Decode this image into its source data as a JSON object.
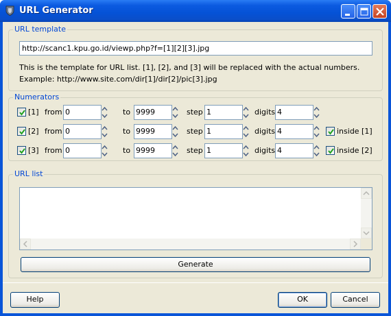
{
  "window": {
    "title": "URL Generator"
  },
  "url_template": {
    "legend": "URL template",
    "value": "http://scanc1.kpu.go.id/viewp.php?f=[1][2][3].jpg",
    "help_line1": "This is the template for URL list. [1], [2], and [3] will be replaced with the actual numbers.",
    "help_line2": "Example: http://www.site.com/dir[1]/dir[2]/pic[3].jpg"
  },
  "numerators": {
    "legend": "Numerators",
    "from_label": "from",
    "to_label": "to",
    "step_label": "step",
    "digits_label": "digits",
    "rows": [
      {
        "label": "[1]",
        "checked": true,
        "from": "0",
        "to": "9999",
        "step": "1",
        "digits": "4",
        "inside_label": ""
      },
      {
        "label": "[2]",
        "checked": true,
        "from": "0",
        "to": "9999",
        "step": "1",
        "digits": "4",
        "inside_label": "inside [1]"
      },
      {
        "label": "[3]",
        "checked": true,
        "from": "0",
        "to": "9999",
        "step": "1",
        "digits": "4",
        "inside_label": "inside [2]"
      }
    ]
  },
  "url_list": {
    "legend": "URL list",
    "generate_label": "Generate"
  },
  "buttons": {
    "help": "Help",
    "ok": "OK",
    "cancel": "Cancel"
  }
}
